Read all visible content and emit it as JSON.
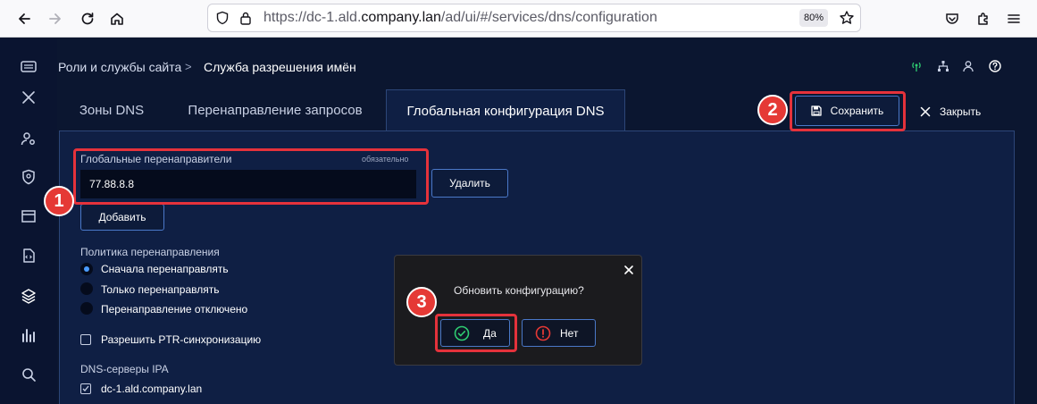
{
  "browser": {
    "url_prefix": "https://dc-1.ald.",
    "url_domain": "company.lan",
    "url_path": "/ad/ui/#/services/dns/configuration",
    "zoom": "80%"
  },
  "breadcrumb": {
    "parent": "Роли и службы сайта",
    "separator": ">",
    "current": "Служба разрешения имён"
  },
  "tabs": [
    {
      "label": "Зоны DNS",
      "active": false
    },
    {
      "label": "Перенаправление запросов",
      "active": false
    },
    {
      "label": "Глобальная конфигурация DNS",
      "active": true
    }
  ],
  "actions": {
    "save_label": "Сохранить",
    "close_label": "Закрыть"
  },
  "forwarders": {
    "label": "Глобальные перенаправители",
    "required": "обязательно",
    "value": "77.88.8.8",
    "delete_label": "Удалить",
    "add_label": "Добавить"
  },
  "policy": {
    "label": "Политика перенаправления",
    "options": [
      {
        "label": "Сначала перенаправлять",
        "selected": true
      },
      {
        "label": "Только перенаправлять",
        "selected": false
      },
      {
        "label": "Перенаправление отключено",
        "selected": false
      }
    ]
  },
  "ptr_sync": {
    "label": "Разрешить PTR-синхронизацию",
    "checked": false
  },
  "ipa_servers": {
    "label": "DNS-серверы IPA",
    "items": [
      {
        "label": "dc-1.ald.company.lan",
        "checked": true
      }
    ]
  },
  "dialog": {
    "title": "Обновить конфигурацию?",
    "yes_label": "Да",
    "no_label": "Нет"
  },
  "markers": [
    "1",
    "2",
    "3"
  ],
  "colors": {
    "background": "#0b1630",
    "panel": "#0f1f44",
    "accent": "#4a78c8",
    "highlight": "#e5323b",
    "success": "#2ecc71",
    "danger": "#e53935"
  }
}
